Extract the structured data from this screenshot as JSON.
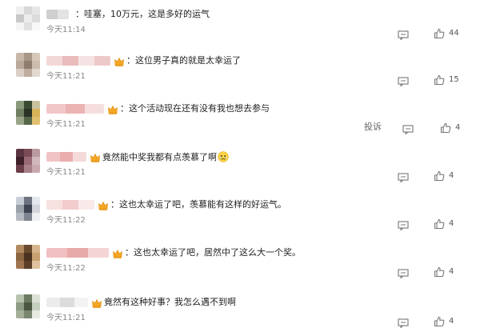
{
  "comments": [
    {
      "text": "：哇塞，10万元，这是多好的运气",
      "time": "今天11:14",
      "likes": "44",
      "has_crown": false,
      "has_report": false,
      "avatar_colors": [
        "#f0f0f0",
        "#d8d8d8",
        "#e6e6e6",
        "#c8c8c8",
        "#ececec",
        "#dcdcdc",
        "#f4f4f4",
        "#e0e0e0",
        "#f8f8f8"
      ],
      "name_colors": [
        "#cfcfcf",
        "#e3e3e3"
      ]
    },
    {
      "text": "：这位男子真的就是太幸运了",
      "time": "今天11:21",
      "likes": "15",
      "has_crown": true,
      "has_report": false,
      "avatar_colors": [
        "#c7b7a8",
        "#a89585",
        "#d5c8bb",
        "#b9a898",
        "#8f7d70",
        "#cbbcad",
        "#d9cfc5",
        "#bfae9d",
        "#e2d9d0"
      ],
      "name_colors": [
        "#f3d8d8",
        "#e9bcbc",
        "#f5e3e3",
        "#eec9c9"
      ]
    },
    {
      "text": "：这个活动现在还有没有我也想去参与",
      "time": "今天11:21",
      "likes": "4",
      "has_crown": true,
      "has_report": true,
      "report_label": "投诉",
      "avatar_colors": [
        "#8a9a7a",
        "#3c4a35",
        "#c9c2a0",
        "#6f7f5f",
        "#2b3326",
        "#d8b35a",
        "#9aa588",
        "#556648",
        "#e0c070"
      ],
      "name_colors": [
        "#f2c7c7",
        "#ecb3b3",
        "#f6dede"
      ]
    },
    {
      "text": "竟然能中奖我都有点羡慕了啊",
      "time": "今天11:21",
      "likes": "4",
      "has_crown": true,
      "has_report": false,
      "has_emoji": true,
      "avatar_colors": [
        "#5a3440",
        "#7a4a55",
        "#b89aa0",
        "#3e2029",
        "#9a6a74",
        "#d0b8bc",
        "#6a3d48",
        "#a88088",
        "#c9a9af"
      ],
      "name_colors": [
        "#f1c4c4",
        "#eaaeae",
        "#f5dada"
      ]
    },
    {
      "text": "：这也太幸运了吧，羡慕能有这样的好运气。",
      "time": "今天11:22",
      "likes": "4",
      "has_crown": true,
      "has_report": false,
      "avatar_colors": [
        "#c9ced6",
        "#6d7480",
        "#e4e7ec",
        "#9aa1ab",
        "#3f4550",
        "#d2d6dc",
        "#b5bac2",
        "#7d848f",
        "#eef0f3"
      ],
      "name_colors": [
        "#f7e0e0",
        "#f2cccc",
        "#fae9e9"
      ]
    },
    {
      "text": "：这也太幸运了吧，居然中了这么大一个奖。",
      "time": "今天11:22",
      "likes": "4",
      "has_crown": true,
      "has_report": false,
      "avatar_colors": [
        "#b08a60",
        "#6a4a2e",
        "#d6b48c",
        "#8c6640",
        "#4a321e",
        "#c9a070",
        "#a07650",
        "#5e4028",
        "#e0c39e"
      ],
      "name_colors": [
        "#f0c0c0",
        "#e8a9a9",
        "#f4d4d4"
      ]
    },
    {
      "text": "竟然有这种好事？我怎么遇不到啊",
      "time": "今天11:21",
      "likes": "4",
      "has_crown": true,
      "has_report": false,
      "avatar_colors": [
        "#b9c4b0",
        "#6c7a62",
        "#dbe2d5",
        "#8f9c85",
        "#4b5743",
        "#c6d0be",
        "#a5b09a",
        "#7a876f",
        "#e6ebe2"
      ],
      "name_colors": [
        "#ececec",
        "#dcdcdc",
        "#f3f3f3"
      ]
    }
  ],
  "icons": {
    "reply": "comment-bubble-icon",
    "like": "thumbs-up-icon",
    "crown": "crown-badge-icon",
    "emoji": "teary-face-emoji"
  },
  "colors": {
    "text": "#222222",
    "timestamp": "#888888",
    "icon": "#777777",
    "crown": "#f5a623"
  }
}
